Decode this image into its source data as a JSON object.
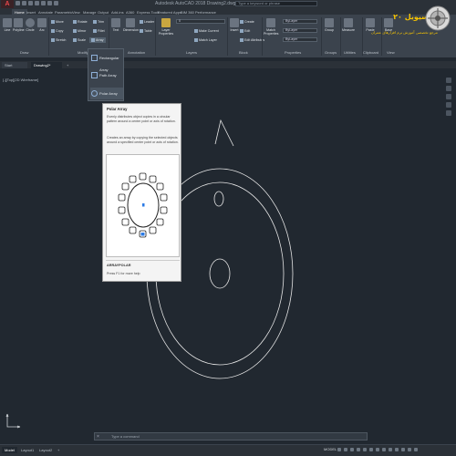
{
  "app": {
    "title": "Autodesk AutoCAD 2018   Drawing2.dwg",
    "search_placeholder": "Type a keyword or phrase"
  },
  "ribbon_tabs": [
    "Home",
    "Insert",
    "Annotate",
    "Parametric",
    "View",
    "Manage",
    "Output",
    "Add-ins",
    "A360",
    "Express Tools",
    "Featured Apps",
    "BIM 360",
    "Performance"
  ],
  "ribbon": {
    "draw": {
      "title": "Draw",
      "tools": [
        "Line",
        "Polyline",
        "Circle",
        "Arc"
      ]
    },
    "modify": {
      "title": "Modify",
      "tools": [
        "Move",
        "Rotate",
        "Trim",
        "Copy",
        "Mirror",
        "Fillet",
        "Stretch",
        "Scale",
        "Array"
      ]
    },
    "annotation": {
      "title": "Annotation",
      "tools": [
        "Text",
        "Dimension",
        "Leader",
        "Table"
      ]
    },
    "layers": {
      "title": "Layers",
      "big": "Layer Properties",
      "dropdown": "0",
      "tools": [
        "Make Current",
        "Match Layer"
      ]
    },
    "block": {
      "title": "Block",
      "big": "Insert",
      "tools": [
        "Create",
        "Edit",
        "Edit Attributes"
      ]
    },
    "properties": {
      "title": "Properties",
      "big": "Match Properties",
      "values": [
        "ByLayer",
        "ByLayer",
        "ByLayer"
      ]
    },
    "groups": {
      "title": "Groups",
      "big": "Group"
    },
    "utilities": {
      "title": "Utilities",
      "big": "Measure"
    },
    "clipboard": {
      "title": "Clipboard",
      "big": "Paste"
    },
    "view": {
      "title": "View",
      "big": "Base"
    }
  },
  "doc_tabs": [
    "Start",
    "Drawing2*"
  ],
  "viewport_label": "[-][Top][2D Wireframe]",
  "array_dropdown": {
    "items": [
      "Rectangular Array",
      "Path Array",
      "Polar Array"
    ]
  },
  "tooltip": {
    "title": "Polar Array",
    "desc1": "Evenly distributes object copies in a circular pattern around a center point or axis of rotation.",
    "desc2": "Creates an array by copying the selected objects around a specified center point or axis of rotation.",
    "command": "ARRAYPOLAR",
    "help": "Press F1 for more help"
  },
  "watermark": {
    "brand": "سیویل ۲۰",
    "subtitle": "مرجع تخصصی آموزش نرم افزارهای عمران"
  },
  "command_line": {
    "placeholder": "Type a command"
  },
  "layout_tabs": [
    "Model",
    "Layout1",
    "Layout2"
  ],
  "status": {
    "mode": "MODEL"
  },
  "colors": {
    "canvas": "#212830",
    "ribbon": "#3b434d",
    "accent_red": "#e8474c",
    "tooltip_bg": "#f4f4f4",
    "highlight_blue": "#2c7be5"
  }
}
